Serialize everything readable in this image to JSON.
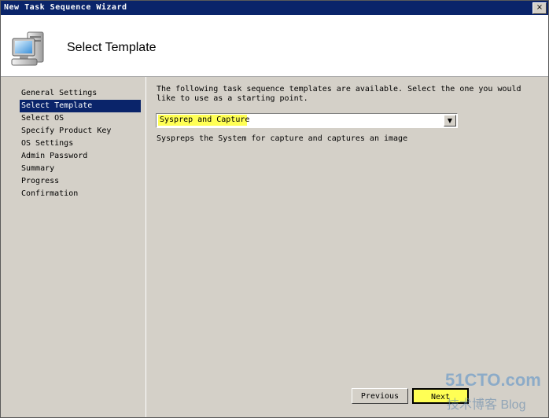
{
  "window": {
    "title": "New Task Sequence Wizard",
    "close_glyph": "×"
  },
  "header": {
    "title": "Select Template",
    "icon": "computer-icon"
  },
  "sidebar": {
    "items": [
      {
        "label": "General Settings"
      },
      {
        "label": "Select Template",
        "selected": true
      },
      {
        "label": "Select OS"
      },
      {
        "label": "Specify Product Key"
      },
      {
        "label": "OS Settings"
      },
      {
        "label": "Admin Password"
      },
      {
        "label": "Summary"
      },
      {
        "label": "Progress"
      },
      {
        "label": "Confirmation"
      }
    ]
  },
  "main": {
    "instructions": "The following task sequence templates are available.  Select the one you would like to use as a starting point.",
    "template_select": {
      "value": "Sysprep and Capture",
      "arrow_glyph": "▼"
    },
    "description": "Syspreps the System for capture and captures an image"
  },
  "buttons": {
    "previous": "Previous",
    "next": "Next"
  },
  "watermark": {
    "line1": "51CTO.com",
    "line2": "技术博客 Blog"
  },
  "colors": {
    "titlebar": "#0a246a",
    "selection": "#0a246a",
    "highlight": "#ffff55",
    "face": "#d4d0c8"
  }
}
